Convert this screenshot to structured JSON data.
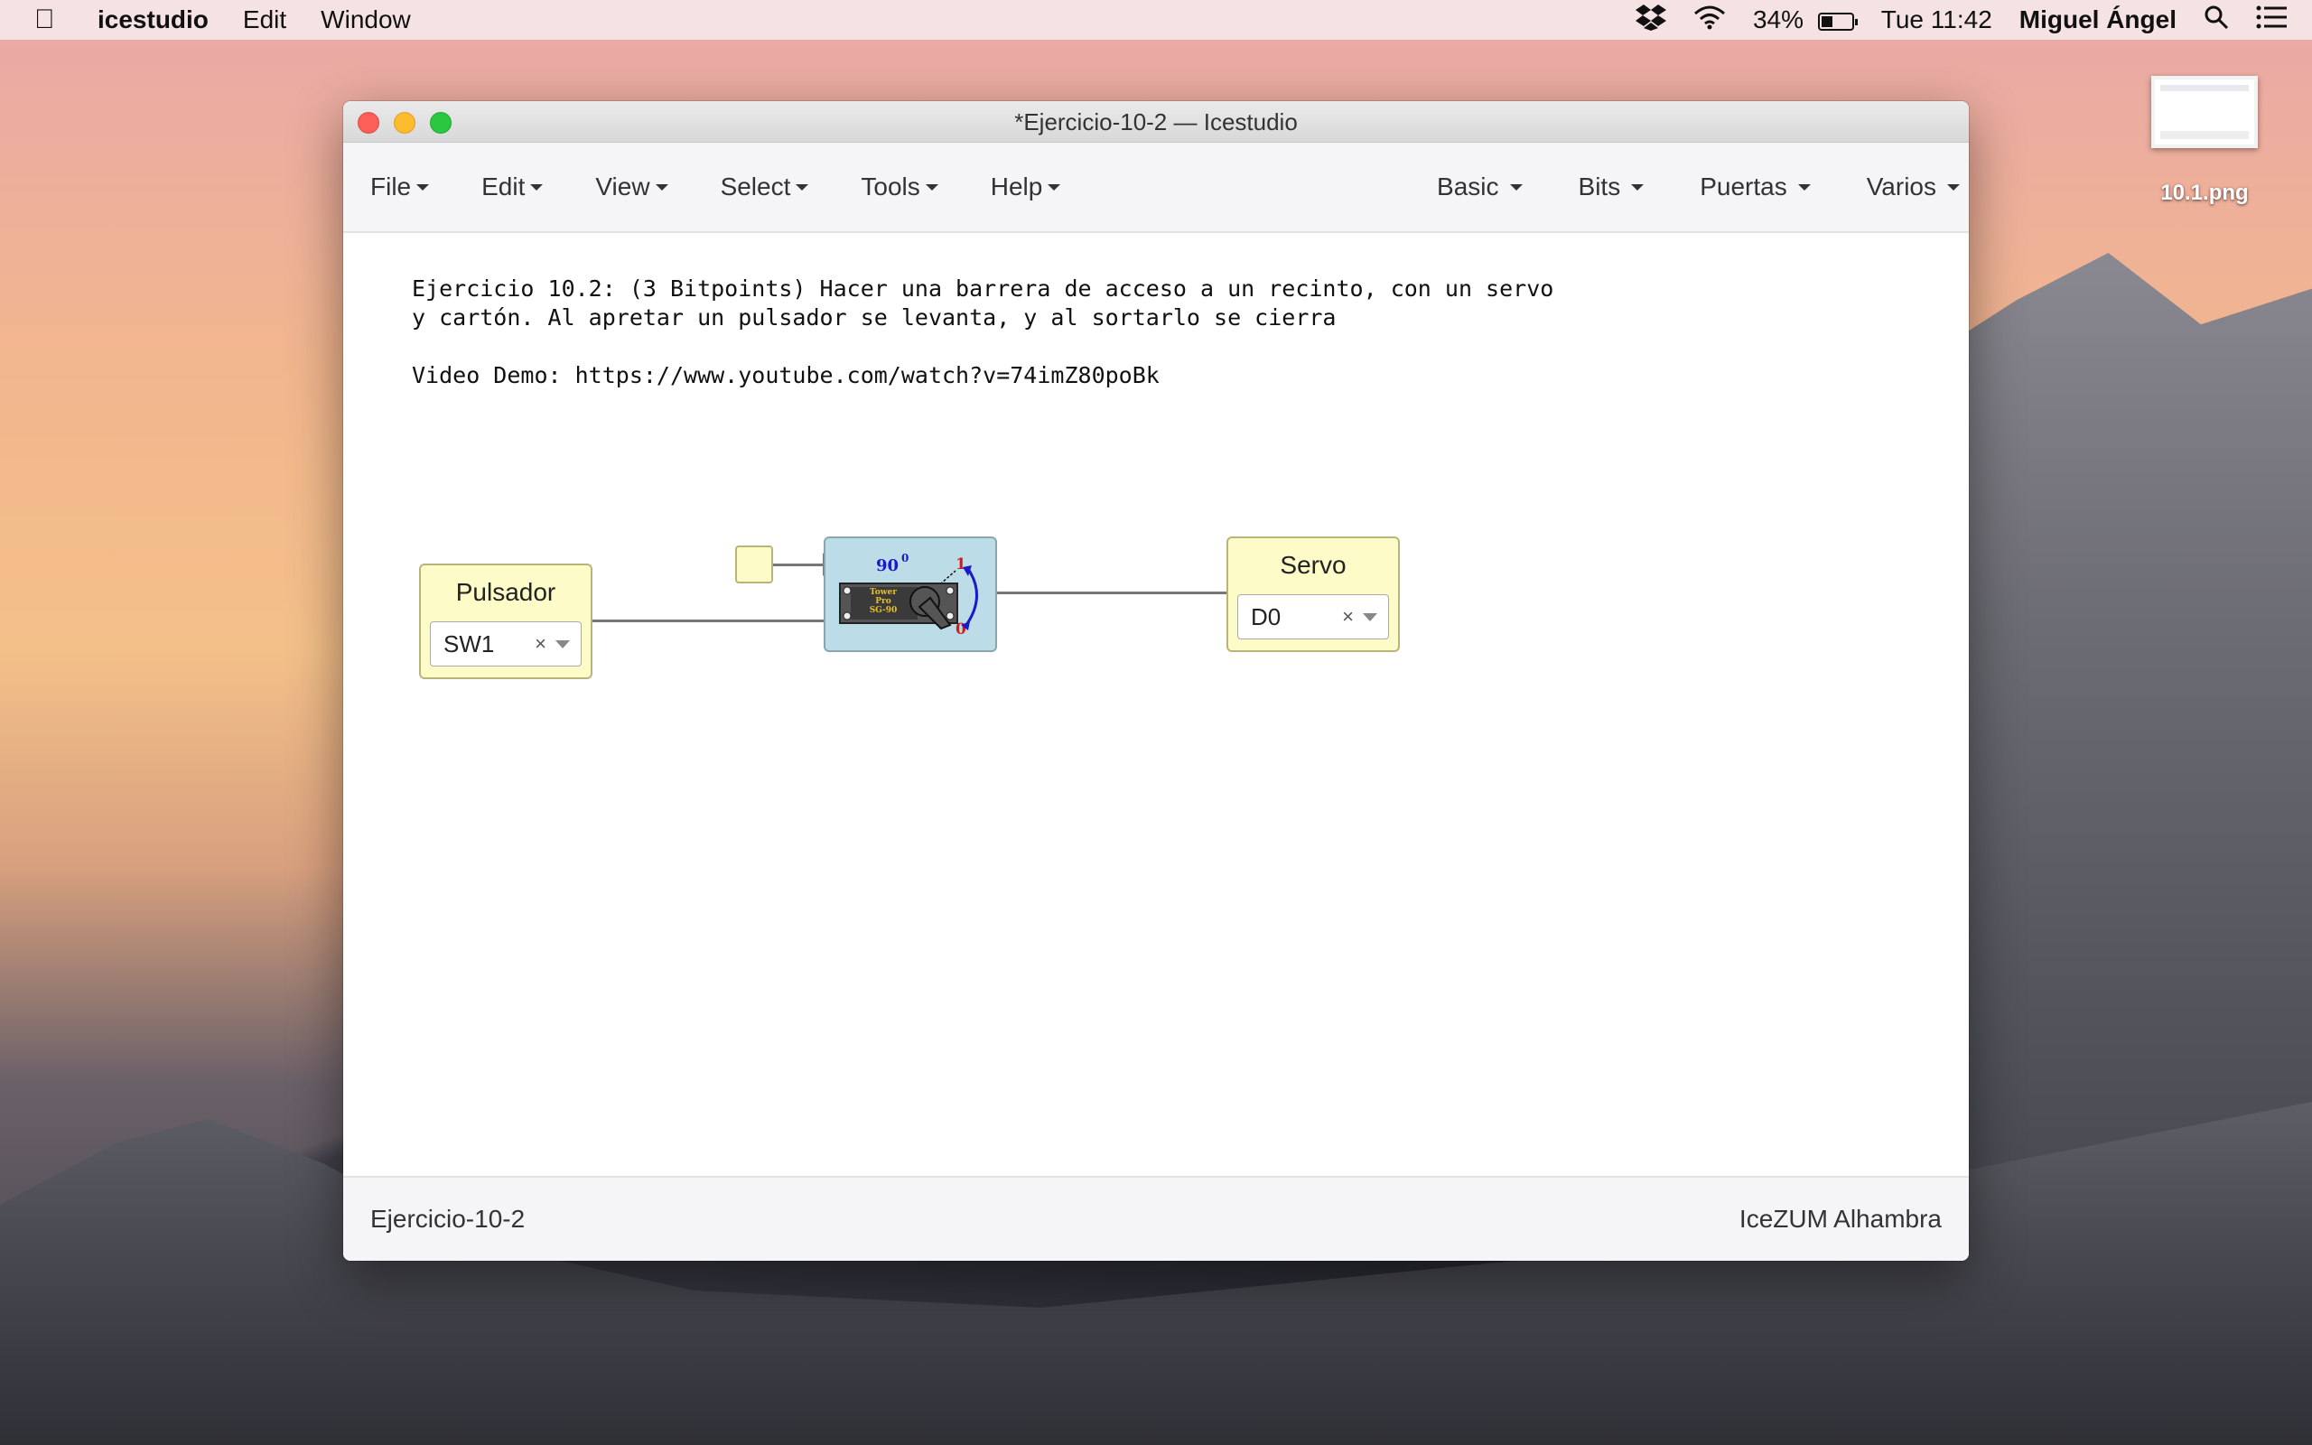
{
  "menubar": {
    "app_name": "icestudio",
    "items": [
      "Edit",
      "Window"
    ],
    "battery": "34%",
    "clock": "Tue 11:42",
    "user": "Miguel Ángel"
  },
  "desktop": {
    "file_label": "10.1.png"
  },
  "window": {
    "title": "*Ejercicio-10-2 — Icestudio",
    "toolbar_left": [
      "File",
      "Edit",
      "View",
      "Select",
      "Tools",
      "Help"
    ],
    "toolbar_right": [
      "Basic",
      "Bits",
      "Puertas",
      "Varios"
    ]
  },
  "canvas": {
    "comment": "Ejercicio 10.2: (3 Bitpoints) Hacer una barrera de acceso a un recinto, con un servo\ny cartón. Al apretar un pulsador se levanta, y al sortarlo se cierra\n\nVideo Demo: https://www.youtube.com/watch?v=74imZ80poBk",
    "input_block": {
      "title": "Pulsador",
      "value": "SW1",
      "clear": "×"
    },
    "output_block": {
      "title": "Servo",
      "value": "D0",
      "clear": "×"
    },
    "servo": {
      "angle_label": "90",
      "degree": "0",
      "high": "1",
      "low": "0",
      "brand": [
        "Tower",
        "Pro",
        "SG-90"
      ]
    }
  },
  "statusbar": {
    "project": "Ejercicio-10-2",
    "board": "IceZUM Alhambra"
  },
  "colors": {
    "block_fill": "#fdfbc8",
    "servo_fill": "#bcdde8",
    "wire": "#777777"
  }
}
